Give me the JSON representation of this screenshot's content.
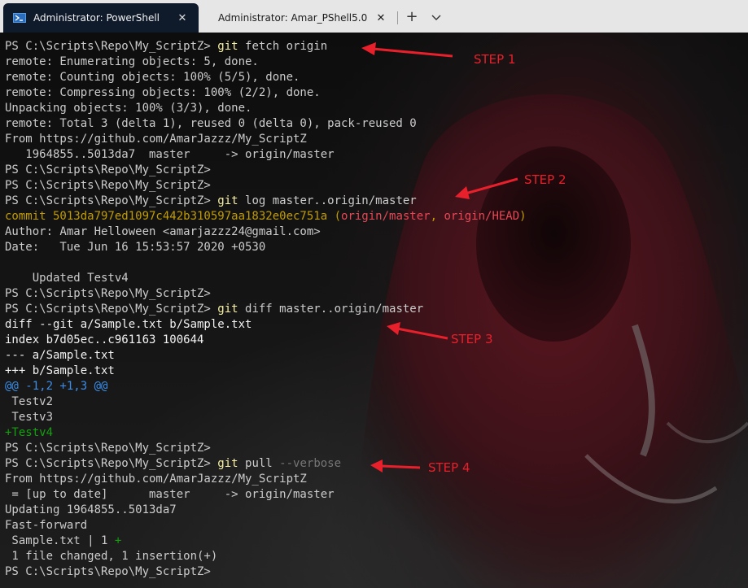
{
  "tabs": [
    {
      "title": "Administrator: PowerShell",
      "close": "✕"
    },
    {
      "title": "Administrator: Amar_PShell5.0",
      "close": "✕"
    }
  ],
  "new_tab": "+",
  "terminal": {
    "lines": [
      [
        {
          "t": "PS C:\\Scripts\\Repo\\My_ScriptZ> ",
          "c": "prompt"
        },
        {
          "t": "git",
          "c": "cmd"
        },
        {
          "t": " fetch origin",
          "c": "param"
        }
      ],
      [
        {
          "t": "remote: Enumerating objects: 5, done.",
          "c": "prompt"
        }
      ],
      [
        {
          "t": "remote: Counting objects: 100% (5/5), done.",
          "c": "prompt"
        }
      ],
      [
        {
          "t": "remote: Compressing objects: 100% (2/2), done.",
          "c": "prompt"
        }
      ],
      [
        {
          "t": "Unpacking objects: 100% (3/3), done.",
          "c": "prompt"
        }
      ],
      [
        {
          "t": "remote: Total 3 (delta 1), reused 0 (delta 0), pack-reused 0",
          "c": "prompt"
        }
      ],
      [
        {
          "t": "From https://github.com/AmarJazzz/My_ScriptZ",
          "c": "prompt"
        }
      ],
      [
        {
          "t": "   1964855..5013da7  master     -> origin/master",
          "c": "prompt"
        }
      ],
      [
        {
          "t": "PS C:\\Scripts\\Repo\\My_ScriptZ>",
          "c": "prompt"
        }
      ],
      [
        {
          "t": "PS C:\\Scripts\\Repo\\My_ScriptZ>",
          "c": "prompt"
        }
      ],
      [
        {
          "t": "PS C:\\Scripts\\Repo\\My_ScriptZ> ",
          "c": "prompt"
        },
        {
          "t": "git",
          "c": "cmd"
        },
        {
          "t": " log master..origin/master",
          "c": "param"
        }
      ],
      [
        {
          "t": "commit 5013da797ed1097c442b310597aa1832e0ec751a (",
          "c": "yellow"
        },
        {
          "t": "origin/master",
          "c": "red"
        },
        {
          "t": ", ",
          "c": "yellow"
        },
        {
          "t": "origin/HEAD",
          "c": "red"
        },
        {
          "t": ")",
          "c": "yellow"
        }
      ],
      [
        {
          "t": "Author: Amar Helloween <amarjazzz24@gmail.com>",
          "c": "prompt"
        }
      ],
      [
        {
          "t": "Date:   Tue Jun 16 15:53:57 2020 +0530",
          "c": "prompt"
        }
      ],
      [
        {
          "t": "",
          "c": "prompt"
        }
      ],
      [
        {
          "t": "    Updated Testv4",
          "c": "prompt"
        }
      ],
      [
        {
          "t": "PS C:\\Scripts\\Repo\\My_ScriptZ>",
          "c": "prompt"
        }
      ],
      [
        {
          "t": "PS C:\\Scripts\\Repo\\My_ScriptZ> ",
          "c": "prompt"
        },
        {
          "t": "git",
          "c": "cmd"
        },
        {
          "t": " diff master..origin/master",
          "c": "param"
        }
      ],
      [
        {
          "t": "diff --git a/Sample.txt b/Sample.txt",
          "c": "white"
        }
      ],
      [
        {
          "t": "index b7d05ec..c961163 100644",
          "c": "white"
        }
      ],
      [
        {
          "t": "--- a/Sample.txt",
          "c": "white"
        }
      ],
      [
        {
          "t": "+++ b/Sample.txt",
          "c": "white"
        }
      ],
      [
        {
          "t": "@@ -1,2 +1,3 @@",
          "c": "blue"
        }
      ],
      [
        {
          "t": " Testv2",
          "c": "prompt"
        }
      ],
      [
        {
          "t": " Testv3",
          "c": "prompt"
        }
      ],
      [
        {
          "t": "+Testv4",
          "c": "green"
        }
      ],
      [
        {
          "t": "PS C:\\Scripts\\Repo\\My_ScriptZ>",
          "c": "prompt"
        }
      ],
      [
        {
          "t": "PS C:\\Scripts\\Repo\\My_ScriptZ> ",
          "c": "prompt"
        },
        {
          "t": "git",
          "c": "cmd"
        },
        {
          "t": " pull ",
          "c": "param"
        },
        {
          "t": "--verbose",
          "c": "dim"
        }
      ],
      [
        {
          "t": "From https://github.com/AmarJazzz/My_ScriptZ",
          "c": "prompt"
        }
      ],
      [
        {
          "t": " = [up to date]      master     -> origin/master",
          "c": "prompt"
        }
      ],
      [
        {
          "t": "Updating 1964855..5013da7",
          "c": "prompt"
        }
      ],
      [
        {
          "t": "Fast-forward",
          "c": "prompt"
        }
      ],
      [
        {
          "t": " Sample.txt | 1 ",
          "c": "prompt"
        },
        {
          "t": "+",
          "c": "green"
        }
      ],
      [
        {
          "t": " 1 file changed, 1 insertion(+)",
          "c": "prompt"
        }
      ],
      [
        {
          "t": "PS C:\\Scripts\\Repo\\My_ScriptZ>",
          "c": "prompt"
        }
      ]
    ]
  },
  "annotations": [
    {
      "label": "STEP 1"
    },
    {
      "label": "STEP 2"
    },
    {
      "label": "STEP 3"
    },
    {
      "label": "STEP 4"
    }
  ],
  "colors": {
    "annotation": "#e8202b",
    "tab_active_bg": "#0f1a2b",
    "tabbar_bg": "#e6e6e6"
  },
  "icons": {
    "tab_icon": "powershell-icon",
    "dropdown": "chevron-down-icon"
  }
}
